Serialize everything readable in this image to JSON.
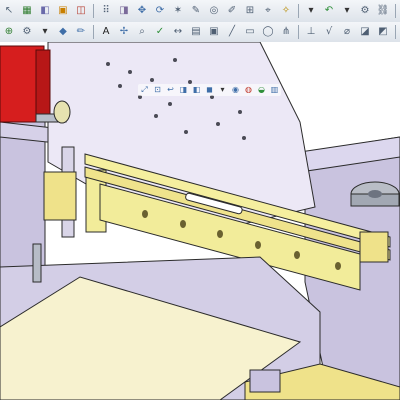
{
  "toolbar_top": {
    "buttons": [
      {
        "icon": "cursor-icon",
        "glyph": "↖",
        "color": "#5a6b7d"
      },
      {
        "icon": "grid-icon",
        "glyph": "▦",
        "color": "#2f7d2f"
      },
      {
        "icon": "view-icon",
        "glyph": "◧",
        "color": "#6a6aaa"
      },
      {
        "icon": "assembly-icon",
        "glyph": "▣",
        "color": "#c87f00"
      },
      {
        "icon": "smart-mates-icon",
        "glyph": "◫",
        "color": "#b5392b"
      },
      {
        "icon": "pattern-icon",
        "glyph": "⠿",
        "color": "#4f5f73"
      },
      {
        "icon": "mirror-icon",
        "glyph": "◨",
        "color": "#7a6a9a"
      },
      {
        "icon": "move-component-icon",
        "glyph": "✥",
        "color": "#3f6ea8"
      },
      {
        "icon": "rotate-component-icon",
        "glyph": "⟳",
        "color": "#3f6ea8"
      },
      {
        "icon": "explode-icon",
        "glyph": "✶",
        "color": "#4f5f73"
      },
      {
        "icon": "sketch-icon",
        "glyph": "✎",
        "color": "#4f5f73"
      },
      {
        "icon": "hide-show-icon",
        "glyph": "◎",
        "color": "#4f5f73"
      },
      {
        "icon": "edit-component-icon",
        "glyph": "✐",
        "color": "#4f5f73"
      },
      {
        "icon": "insert-icon",
        "glyph": "⊞",
        "color": "#4f5f73"
      },
      {
        "icon": "reference-icon",
        "glyph": "⌖",
        "color": "#4f5f73"
      },
      {
        "icon": "magic-wand-icon",
        "glyph": "✧",
        "color": "#b58a00"
      },
      {
        "icon": "dropdown-arrow-icon",
        "glyph": "▾",
        "color": "#333333"
      },
      {
        "icon": "undo-curve-icon",
        "glyph": "↶",
        "color": "#2f8f3a"
      },
      {
        "icon": "dropdown-arrow-icon",
        "glyph": "▾",
        "color": "#333333"
      },
      {
        "icon": "options-icon",
        "glyph": "⚙",
        "color": "#4f5f73"
      },
      {
        "icon": "link-icon",
        "glyph": "⛓",
        "color": "#4f5f73"
      },
      {
        "icon": "flag-icon",
        "glyph": "⚑",
        "color": "#4f5f73"
      },
      {
        "icon": "measure-icon",
        "glyph": "⊿",
        "color": "#4f5f73"
      },
      {
        "icon": "cut-icon",
        "glyph": "✂",
        "color": "#4f5f73"
      },
      {
        "icon": "copy-icon",
        "glyph": "⎘",
        "color": "#4f5f73"
      },
      {
        "icon": "paste-icon",
        "glyph": "▤",
        "color": "#4f5f73"
      },
      {
        "icon": "print-icon",
        "glyph": "⎙",
        "color": "#4f5f73"
      },
      {
        "icon": "search-icon",
        "glyph": "⌕",
        "color": "#4f5f73"
      },
      {
        "icon": "tools-icon",
        "glyph": "✑",
        "color": "#4f5f73"
      },
      {
        "icon": "weld-icon",
        "glyph": "✤",
        "color": "#b5392b"
      },
      {
        "icon": "help-icon",
        "glyph": "?",
        "color": "#3f6ea8"
      },
      {
        "icon": "folder-icon",
        "glyph": "▥",
        "color": "#c9a227"
      },
      {
        "icon": "addin-icon",
        "glyph": "▩",
        "color": "#2f7d2f"
      }
    ]
  },
  "toolbar_second": {
    "buttons": [
      {
        "icon": "mate-icon",
        "glyph": "⊕",
        "color": "#2f7d2f"
      },
      {
        "icon": "settings-icon",
        "glyph": "⚙",
        "color": "#4f5f73"
      },
      {
        "icon": "dropdown-arrow-icon",
        "glyph": "▾",
        "color": "#333333"
      },
      {
        "icon": "diamond-icon",
        "glyph": "◆",
        "color": "#3f6ea8"
      },
      {
        "icon": "pencil-icon",
        "glyph": "✏",
        "color": "#3f6ea8"
      },
      {
        "icon": "text-a-icon",
        "glyph": "A",
        "color": "#222222"
      },
      {
        "icon": "sketch-point-icon",
        "glyph": "✢",
        "color": "#3f6ea8"
      },
      {
        "icon": "zoom-icon",
        "glyph": "⌕",
        "color": "#4f5f73"
      },
      {
        "icon": "check-icon",
        "glyph": "✓",
        "color": "#2f8f3a"
      },
      {
        "icon": "smart-dimension-icon",
        "glyph": "↔",
        "color": "#4f5f73"
      },
      {
        "icon": "table-icon",
        "glyph": "▤",
        "color": "#4f5f73"
      },
      {
        "icon": "block-icon",
        "glyph": "▣",
        "color": "#4f5f73"
      },
      {
        "icon": "line-icon",
        "glyph": "╱",
        "color": "#4f5f73"
      },
      {
        "icon": "note-icon",
        "glyph": "▭",
        "color": "#4f5f73"
      },
      {
        "icon": "balloon-icon",
        "glyph": "◯",
        "color": "#4f5f73"
      },
      {
        "icon": "weld-symbol-icon",
        "glyph": "⋔",
        "color": "#4f5f73"
      },
      {
        "icon": "datum-icon",
        "glyph": "⊥",
        "color": "#4f5f73"
      },
      {
        "icon": "surface-finish-icon",
        "glyph": "√",
        "color": "#4f5f73"
      },
      {
        "icon": "hole-callout-icon",
        "glyph": "⌀",
        "color": "#4f5f73"
      },
      {
        "icon": "layer-icon",
        "glyph": "◪",
        "color": "#4f5f73"
      },
      {
        "icon": "shaded-icon",
        "glyph": "◩",
        "color": "#4f5f73"
      },
      {
        "icon": "dropdown-arrow-icon",
        "glyph": "▾",
        "color": "#333333"
      },
      {
        "icon": "lights-icon",
        "glyph": "◐",
        "color": "#4f5f73"
      },
      {
        "icon": "grid-toggle-icon",
        "glyph": "⊞",
        "color": "#4f5f73"
      },
      {
        "icon": "dropdown-arrow-icon",
        "glyph": "▾",
        "color": "#333333"
      }
    ]
  },
  "heads_up_view": {
    "buttons": [
      {
        "icon": "zoom-to-fit-icon",
        "glyph": "⤢",
        "color": "#3f6ea8"
      },
      {
        "icon": "zoom-area-icon",
        "glyph": "⊡",
        "color": "#3f6ea8"
      },
      {
        "icon": "previous-view-icon",
        "glyph": "↩",
        "color": "#3f6ea8"
      },
      {
        "icon": "section-view-icon",
        "glyph": "◨",
        "color": "#3f6ea8"
      },
      {
        "icon": "view-orientation-icon",
        "glyph": "◧",
        "color": "#3f6ea8"
      },
      {
        "icon": "display-style-icon",
        "glyph": "◼",
        "color": "#3f6ea8"
      },
      {
        "icon": "dropdown-arrow-icon",
        "glyph": "▾",
        "color": "#333333"
      },
      {
        "icon": "hide-items-icon",
        "glyph": "◉",
        "color": "#3f6ea8"
      },
      {
        "icon": "edit-appearance-icon",
        "glyph": "◍",
        "color": "#c0392b"
      },
      {
        "icon": "scene-icon",
        "glyph": "◒",
        "color": "#2f8f3a"
      },
      {
        "icon": "view-settings-icon",
        "glyph": "▥",
        "color": "#3f6ea8"
      }
    ]
  },
  "model": {
    "colors": {
      "frame": "#c9c3df",
      "frame_edge": "#2b2b2b",
      "plate": "#ece8f6",
      "belt": "#f2ec9a",
      "motor": "#d61e1e",
      "table": "#f7f2cf",
      "steel": "#8c96a8"
    }
  }
}
